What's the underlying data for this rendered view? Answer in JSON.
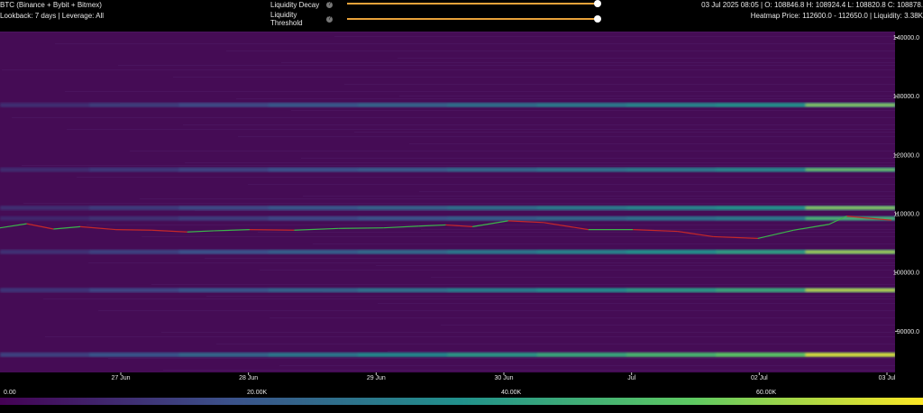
{
  "header": {
    "title": "BTC (Binance + Bybit + Bitmex)",
    "subtitle": "Lookback: 7 days | Leverage: All",
    "ohlc": "03 Jul 2025 08:05 | O: 108846.8 H: 108924.4 L: 108820.8 C: 108878.",
    "heatmap_info": "Heatmap Price: 112600.0 - 112650.0 | Liquidity: 3.38K"
  },
  "controls": {
    "decay": {
      "label": "Liquidity Decay",
      "value": 1.0
    },
    "threshold": {
      "label": "Liquidity Threshold",
      "value": 1.0
    },
    "info_glyph": "?"
  },
  "colors": {
    "background": "#450c55",
    "price_line_up": "#3cb44b",
    "price_line_down": "#c62828",
    "slider_fill": "#e8a23a"
  },
  "colorbar": {
    "labels": [
      "0.00",
      "20.00K",
      "40.00K",
      "60.00K"
    ]
  },
  "chart_data": {
    "type": "heatmap",
    "x_ticks": [
      "27 Jun",
      "28 Jun",
      "29 Jun",
      "30 Jun",
      "Jul",
      "02 Jul",
      "03 Jul"
    ],
    "y_ticks": [
      "140000.0",
      "130000.0",
      "120000.0",
      "110000.0",
      "100000.0",
      "90000.0"
    ],
    "ylim": [
      83000,
      141000
    ],
    "liquidity_bands": [
      {
        "price": 128500,
        "intensity": 0.55
      },
      {
        "price": 117500,
        "intensity": 0.5
      },
      {
        "price": 111000,
        "intensity": 0.55
      },
      {
        "price": 109200,
        "intensity": 0.45
      },
      {
        "price": 103500,
        "intensity": 0.6
      },
      {
        "price": 97000,
        "intensity": 0.65
      },
      {
        "price": 86000,
        "intensity": 0.8
      }
    ],
    "price_series": [
      {
        "t": 0.0,
        "p": 107600
      },
      {
        "t": 0.03,
        "p": 108300
      },
      {
        "t": 0.06,
        "p": 107400
      },
      {
        "t": 0.09,
        "p": 107800
      },
      {
        "t": 0.13,
        "p": 107300
      },
      {
        "t": 0.17,
        "p": 107200
      },
      {
        "t": 0.21,
        "p": 106900
      },
      {
        "t": 0.24,
        "p": 107100
      },
      {
        "t": 0.28,
        "p": 107300
      },
      {
        "t": 0.33,
        "p": 107200
      },
      {
        "t": 0.38,
        "p": 107500
      },
      {
        "t": 0.43,
        "p": 107600
      },
      {
        "t": 0.47,
        "p": 107900
      },
      {
        "t": 0.5,
        "p": 108100
      },
      {
        "t": 0.53,
        "p": 107800
      },
      {
        "t": 0.57,
        "p": 108800
      },
      {
        "t": 0.61,
        "p": 108500
      },
      {
        "t": 0.66,
        "p": 107300
      },
      {
        "t": 0.71,
        "p": 107300
      },
      {
        "t": 0.76,
        "p": 107000
      },
      {
        "t": 0.8,
        "p": 106100
      },
      {
        "t": 0.85,
        "p": 105800
      },
      {
        "t": 0.89,
        "p": 107200
      },
      {
        "t": 0.93,
        "p": 108200
      },
      {
        "t": 0.95,
        "p": 109600
      },
      {
        "t": 0.97,
        "p": 109300
      },
      {
        "t": 1.0,
        "p": 108900
      }
    ]
  }
}
